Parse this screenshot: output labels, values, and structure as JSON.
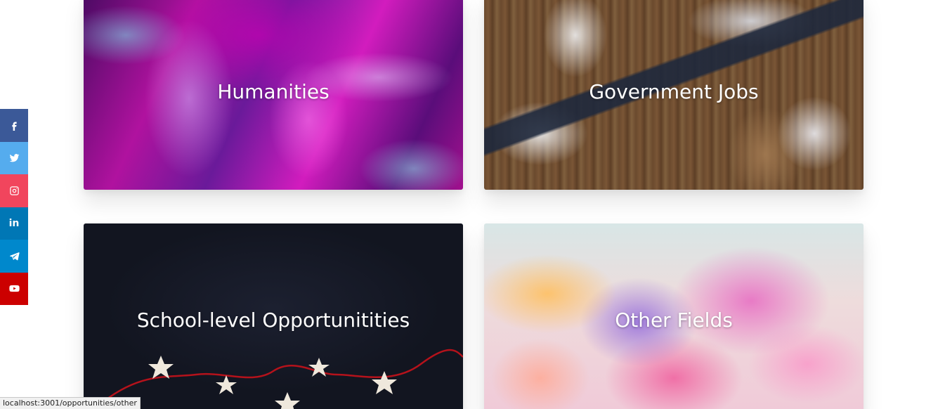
{
  "social": {
    "items": [
      {
        "name": "facebook",
        "icon": "facebook-icon",
        "color": "#3b5998"
      },
      {
        "name": "twitter",
        "icon": "twitter-icon",
        "color": "#55acee"
      },
      {
        "name": "instagram",
        "icon": "instagram-icon",
        "color": "#f1455d"
      },
      {
        "name": "linkedin",
        "icon": "linkedin-icon",
        "color": "#0077b5",
        "glyph": "in"
      },
      {
        "name": "telegram",
        "icon": "telegram-icon",
        "color": "#0088cc"
      },
      {
        "name": "youtube",
        "icon": "youtube-icon",
        "color": "#cc0000"
      }
    ]
  },
  "cards": {
    "humanities": {
      "title": "Humanities"
    },
    "government": {
      "title": "Government Jobs"
    },
    "school": {
      "title": "School-level Opportunitities"
    },
    "other": {
      "title": "Other Fields"
    }
  },
  "status_bar": {
    "url": "localhost:3001/opportunities/other"
  }
}
